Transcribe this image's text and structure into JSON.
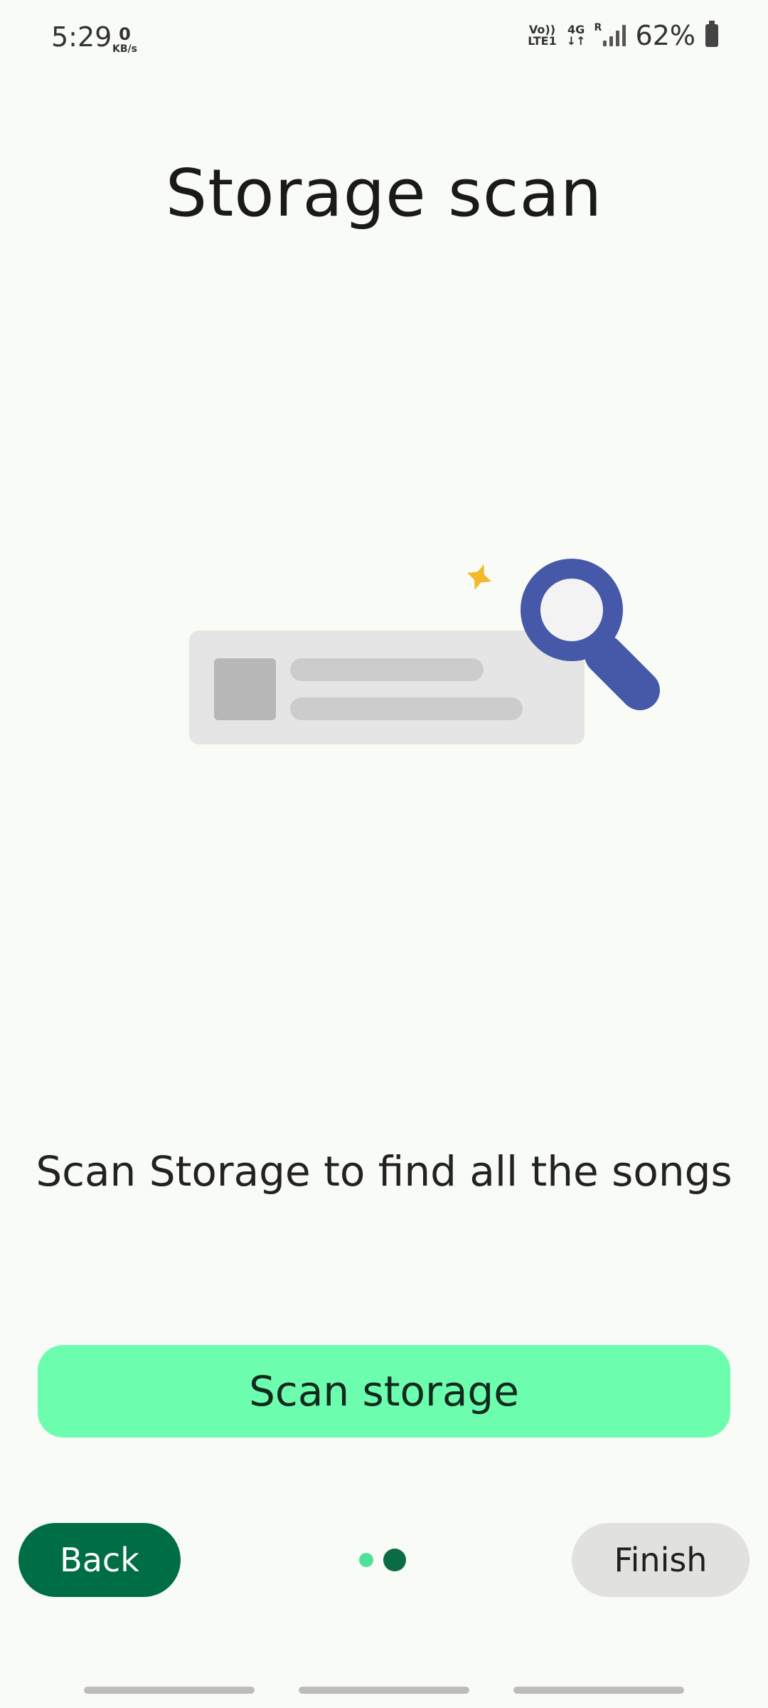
{
  "status_bar": {
    "time": "5:29",
    "net_speed_value": "0",
    "net_speed_unit": "KB/s",
    "volte_top": "Vo))",
    "volte_bottom": "LTE1",
    "network_type": "4G",
    "roaming": "R",
    "battery_percent": "62%"
  },
  "page": {
    "title": "Storage scan",
    "description": "Scan Storage to find all the songs"
  },
  "actions": {
    "scan_label": "Scan storage",
    "back_label": "Back",
    "finish_label": "Finish"
  },
  "page_indicator": {
    "total": 2,
    "current": 2
  },
  "colors": {
    "background": "#f9fbf7",
    "scan_button": "#6dfdae",
    "back_button": "#006e44",
    "finish_button": "#e1e2de",
    "magnifier": "#4659a8",
    "sparkle": "#f3b92b"
  }
}
